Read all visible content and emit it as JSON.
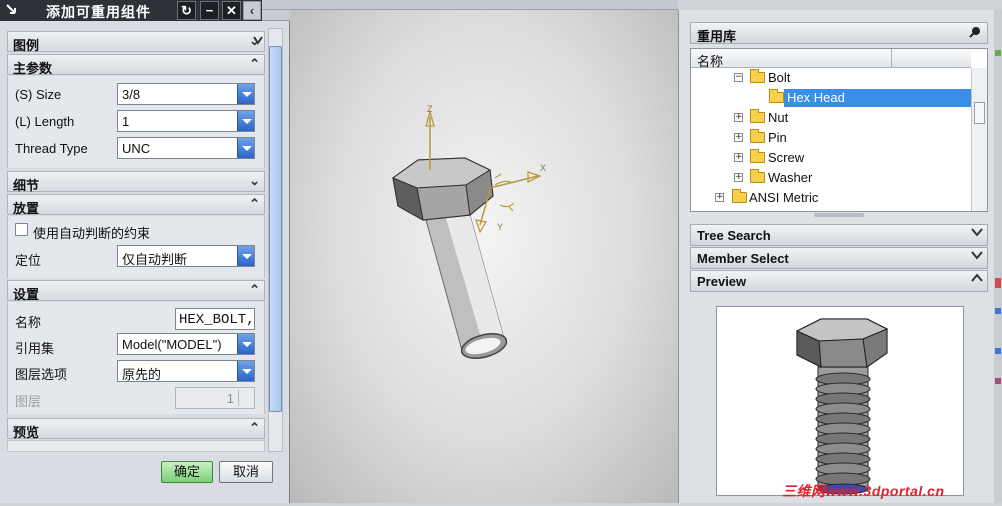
{
  "dialog": {
    "title": "添加可重用组件",
    "title_buttons": [
      "↻",
      "−",
      "✕"
    ],
    "sections": {
      "legend": "图例",
      "main_params": "主参数",
      "details": "细节",
      "placement": "放置",
      "settings": "设置",
      "preview": "预览"
    },
    "params": [
      {
        "label": "(S) Size",
        "value": "3/8"
      },
      {
        "label": "(L) Length",
        "value": "1"
      },
      {
        "label": "Thread Type",
        "value": "UNC"
      }
    ],
    "placement": {
      "auto_constraint_label": "使用自动判断的约束",
      "position_label": "定位",
      "position_value": "仅自动判断"
    },
    "settings": {
      "name_label": "名称",
      "name_value": "HEX_BOLT,",
      "refset_label": "引用集",
      "refset_value": "Model(\"MODEL\")",
      "layer_option_label": "图层选项",
      "layer_option_value": "原先的",
      "layer_label": "图层",
      "layer_value": "1"
    },
    "ok_label": "确定",
    "cancel_label": "取消"
  },
  "viewport": {
    "axis_x": "X",
    "axis_y": "Y",
    "axis_z": "Z"
  },
  "library": {
    "title": "重用库",
    "column_name": "名称",
    "tree": [
      {
        "label": "Bolt",
        "level": 1,
        "expanded": true
      },
      {
        "label": "Hex Head",
        "level": 2,
        "selected": true
      },
      {
        "label": "Nut",
        "level": 1
      },
      {
        "label": "Pin",
        "level": 1
      },
      {
        "label": "Screw",
        "level": 1
      },
      {
        "label": "Washer",
        "level": 1
      },
      {
        "label": "ANSI Metric",
        "level": 0
      }
    ],
    "tree_search": "Tree Search",
    "member_select": "Member Select",
    "preview": "Preview"
  },
  "watermark": "三维网www.3dportal.cn",
  "colors": {
    "selection": "#3b8ee6",
    "combo_arrow": "#2a64c6",
    "ok_button": "#8fd48a"
  }
}
